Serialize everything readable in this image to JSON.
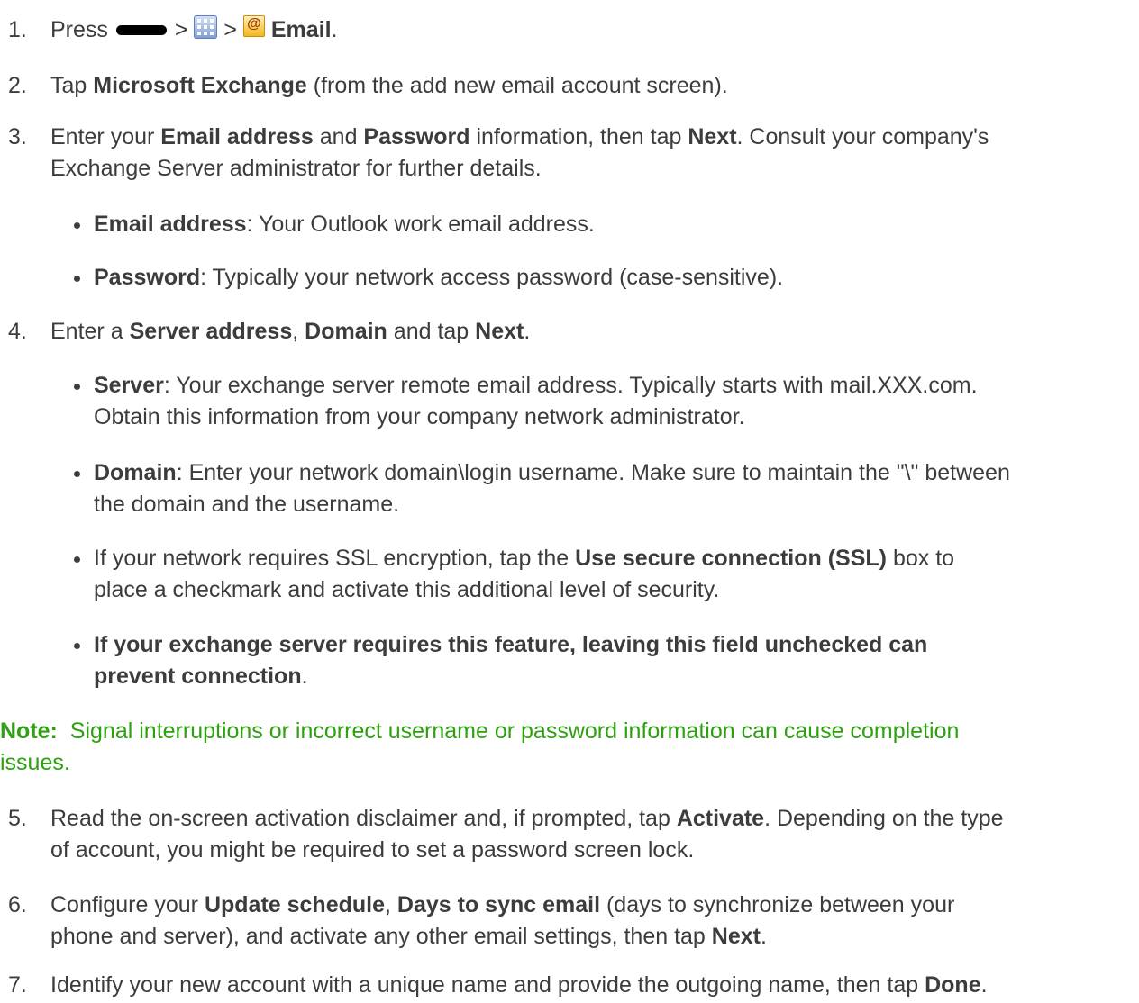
{
  "steps": {
    "s1": {
      "num": "1.",
      "press": "Press",
      "gt": ">",
      "email": "Email",
      "end": "."
    },
    "s2": {
      "num": "2.",
      "a": "Tap ",
      "b": "Microsoft Exchange",
      "c": " (from the add new email account screen)."
    },
    "s3": {
      "num": "3.",
      "l1a": "Enter your ",
      "l1b": "Email address",
      "l1c": " and ",
      "l1d": "Password",
      "l1e": " information, then tap ",
      "l1f": "Next",
      "l1g": ". Consult your company's",
      "l2": "Exchange Server administrator for further details.",
      "b1b": "Email address",
      "b1t": ": Your Outlook work email address.",
      "b2b": "Password",
      "b2t": ": Typically your network access password (case-sensitive)."
    },
    "s4": {
      "num": "4.",
      "a": "Enter a ",
      "b": "Server address",
      "c": ", ",
      "d": "Domain",
      "e": " and tap ",
      "f": "Next",
      "g": ".",
      "b1b": "Server",
      "b1t1": ": Your exchange server remote email address. Typically starts with mail.XXX.com.",
      "b1t2": "Obtain this information from your company network administrator.",
      "b2b": "Domain",
      "b2t1": ": Enter your network domain\\login username. Make sure to maintain the \"\\\" between",
      "b2t2": "the domain and the username.",
      "b3a": "If your network requires SSL encryption, tap the ",
      "b3b": "Use secure connection (SSL)",
      "b3c": " box to",
      "b3t2": "place a checkmark and activate this additional level of security.",
      "b4b1": "If your exchange server requires this feature, leaving this field unchecked can",
      "b4b2": "prevent connection",
      "b4c": "."
    },
    "note": {
      "label": "Note:",
      "l1": "Signal interruptions or incorrect username or password information can cause completion",
      "l2": "issues."
    },
    "s5": {
      "num": "5.",
      "a": "Read the on-screen activation disclaimer and, if prompted, tap ",
      "b": "Activate",
      "c": ". Depending on the type",
      "l2": "of account, you might be required to set a password screen lock."
    },
    "s6": {
      "num": "6.",
      "a": "Configure your ",
      "b": "Update schedule",
      "c": ", ",
      "d": "Days to sync email",
      "e": " (days to synchronize between your",
      "l2a": "phone and server), and activate any other email settings, then tap ",
      "l2b": "Next",
      "l2c": "."
    },
    "s7": {
      "num": "7.",
      "a": "Identify your new account with a unique name and provide the outgoing name, then tap ",
      "b": "Done",
      "c": "."
    }
  },
  "icons": {
    "menu_key": "menu-key-icon",
    "apps": "apps-grid-icon",
    "email": "email-app-icon",
    "email_glyph": "@"
  }
}
